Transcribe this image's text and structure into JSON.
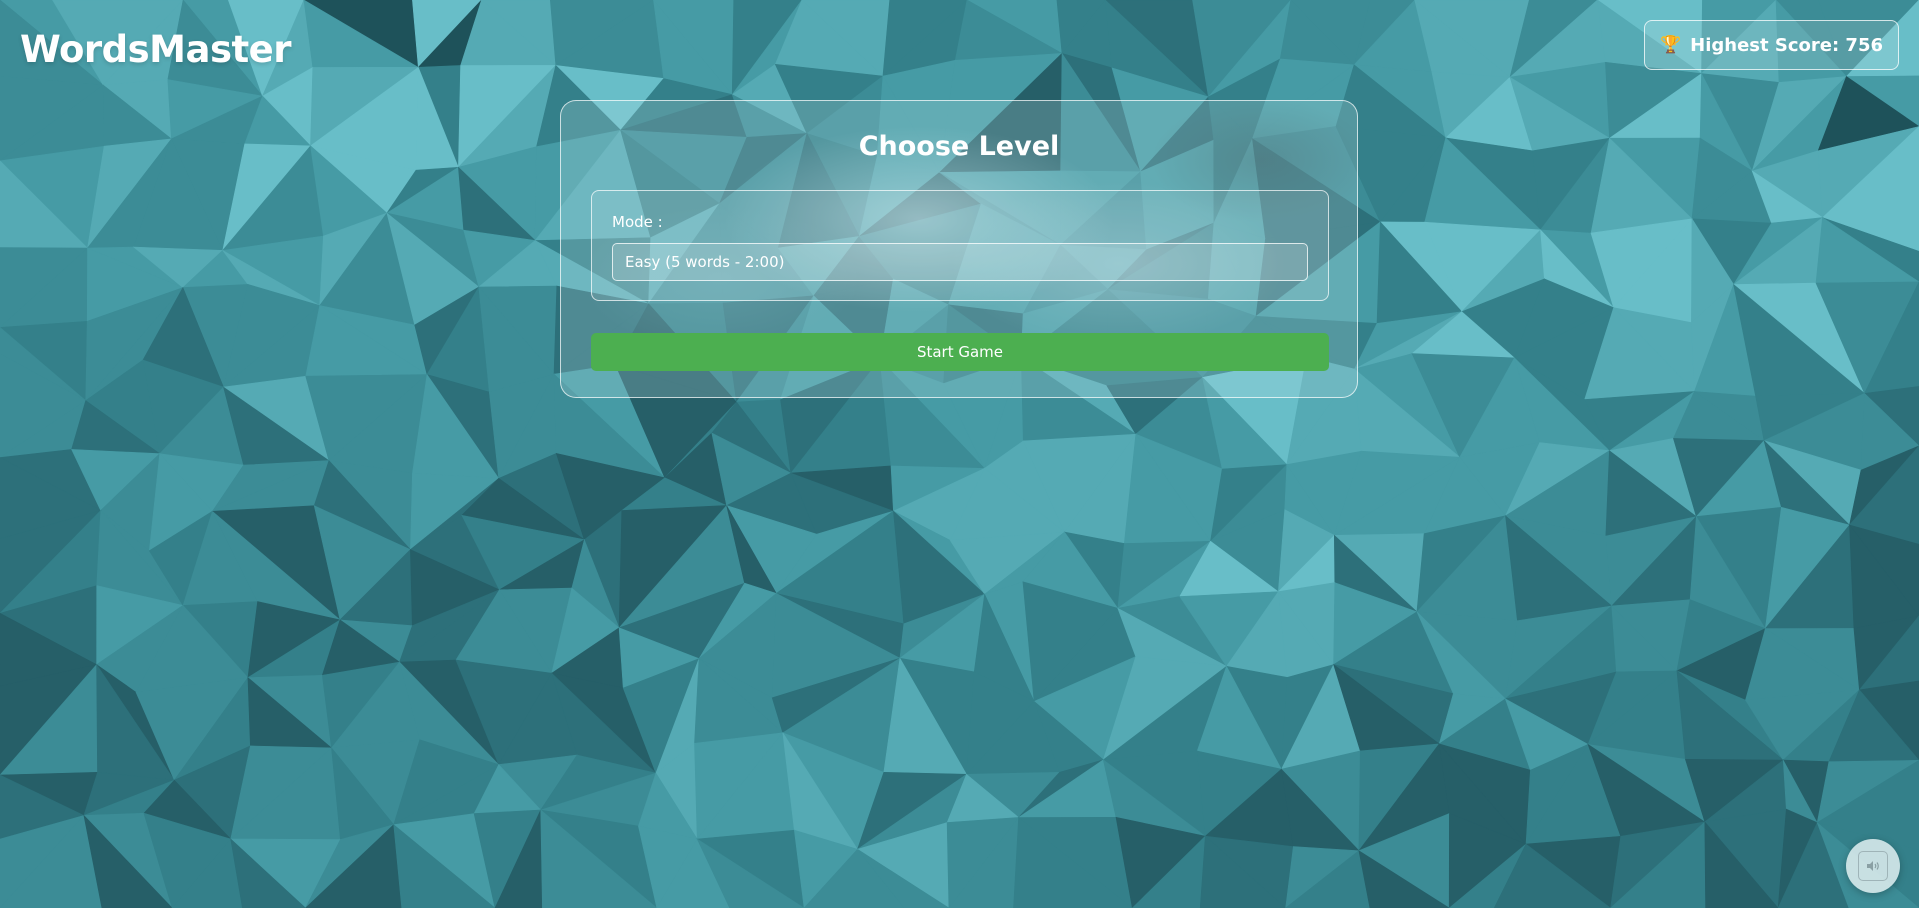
{
  "app": {
    "title": "WordsMaster"
  },
  "header": {
    "score_icon": "trophy-icon",
    "score_text": "Highest Score: 756"
  },
  "level_panel": {
    "title": "Choose Level",
    "mode_label": "Mode :",
    "mode_selected": "Easy (5 words - 2:00)",
    "start_button": "Start Game"
  },
  "controls": {
    "sound_icon": "speaker-icon"
  },
  "colors": {
    "background": "#2f7e88",
    "start_button": "#4caf50",
    "text": "#ffffff"
  }
}
